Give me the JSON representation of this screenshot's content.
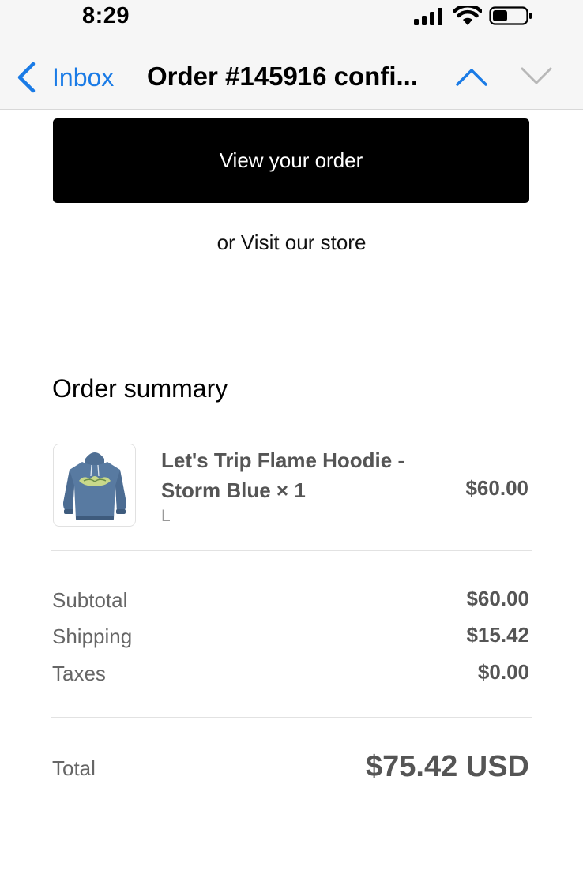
{
  "status_bar": {
    "time": "8:29",
    "icons": [
      "cellular-signal-icon",
      "wifi-icon",
      "battery-icon"
    ]
  },
  "nav": {
    "back_label": "Inbox",
    "title": "Order #145916 confi...",
    "accent_color": "#1a7be6",
    "icons": [
      "back-chevron-icon",
      "previous-message-icon",
      "next-message-icon"
    ]
  },
  "email": {
    "view_order_label": "View your order",
    "visit_store_prefix": "or ",
    "visit_store_link": "Visit our store",
    "summary_heading": "Order summary",
    "item": {
      "name": "Let's Trip Flame Hoodie - Storm Blue × 1",
      "variant": "L",
      "price": "$60.00",
      "thumbnail_icon": "hoodie-image"
    },
    "lines": [
      {
        "label": "Subtotal",
        "value": "$60.00"
      },
      {
        "label": "Shipping",
        "value": "$15.42"
      },
      {
        "label": "Taxes",
        "value": "$0.00"
      }
    ],
    "total_label": "Total",
    "total_value": "$75.42 USD"
  }
}
